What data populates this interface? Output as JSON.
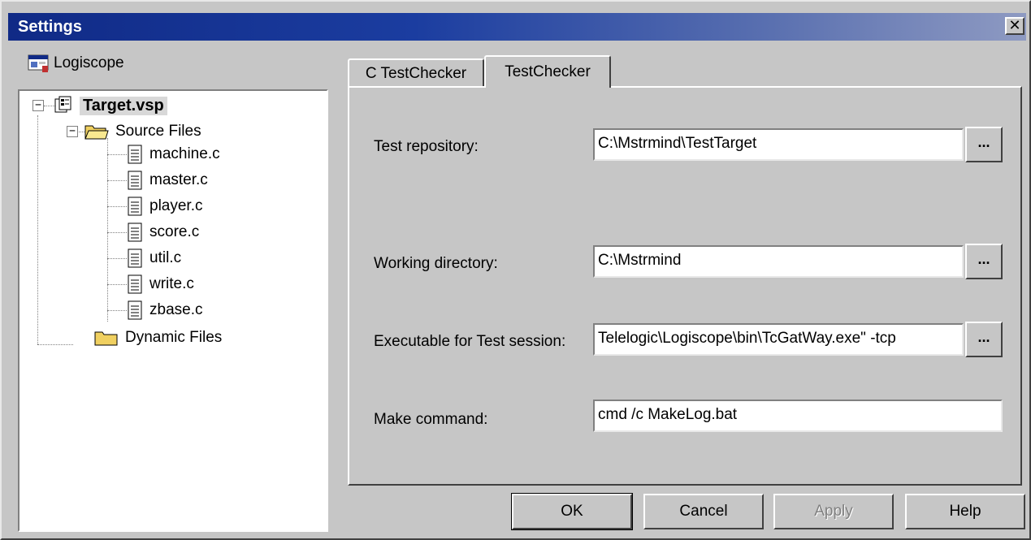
{
  "window": {
    "title": "Settings",
    "close_label": "✕"
  },
  "tree": {
    "root_label": "Logiscope",
    "project": "Target.vsp",
    "source_folder": "Source Files",
    "files": [
      "machine.c",
      "master.c",
      "player.c",
      "score.c",
      "util.c",
      "write.c",
      "zbase.c"
    ],
    "dynamic_folder": "Dynamic Files",
    "expander_symbol": "−"
  },
  "tabs": [
    {
      "label": "C TestChecker",
      "active": false
    },
    {
      "label": "TestChecker",
      "active": true
    }
  ],
  "form": {
    "test_repository": {
      "label": "Test repository:",
      "value": "C:\\Mstrmind\\TestTarget"
    },
    "working_directory": {
      "label": "Working directory:",
      "value": "C:\\Mstrmind"
    },
    "executable": {
      "label": "Executable for Test session:",
      "value": "Telelogic\\Logiscope\\bin\\TcGatWay.exe\" -tcp"
    },
    "make_command": {
      "label": "Make command:",
      "value": "cmd /c MakeLog.bat"
    },
    "browse_label": "..."
  },
  "buttons": {
    "ok": "OK",
    "cancel": "Cancel",
    "apply": "Apply",
    "help": "Help"
  },
  "icons": {
    "project": "project-icon",
    "folder": "folder-icon",
    "file": "file-icon",
    "app": "logiscope-app-icon"
  },
  "colors": {
    "titlebar": "#102a86",
    "folder": "#f0d060",
    "panel": "#c6c6c6"
  }
}
